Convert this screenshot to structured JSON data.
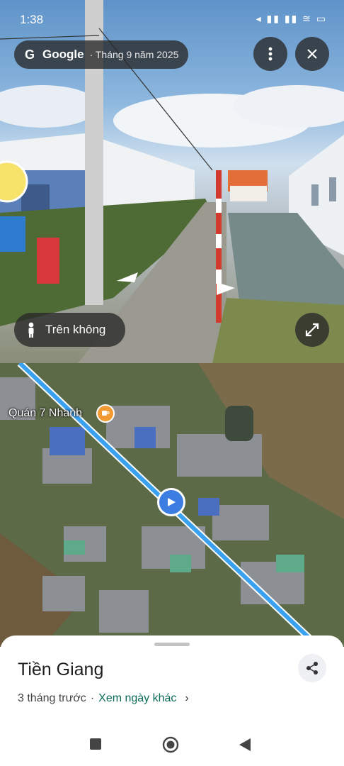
{
  "status_bar": {
    "time": "1:38",
    "icons": "◂ ▮▮ ▮▮ ≋ ▭"
  },
  "streetview": {
    "brand": "Google",
    "date": "· Tháng 9 năm 2025",
    "mode_label": "Trên không"
  },
  "map": {
    "place_name": "Quán 7 Nhanh"
  },
  "sheet": {
    "title": "Tiền Giang",
    "ago": "3 tháng trước",
    "separator": "·",
    "link": "Xem ngày khác"
  },
  "colors": {
    "route": "#3aa0f0",
    "pegman": "#3b7de0",
    "place_icon": "#f29a32",
    "link": "#0b6b57"
  }
}
